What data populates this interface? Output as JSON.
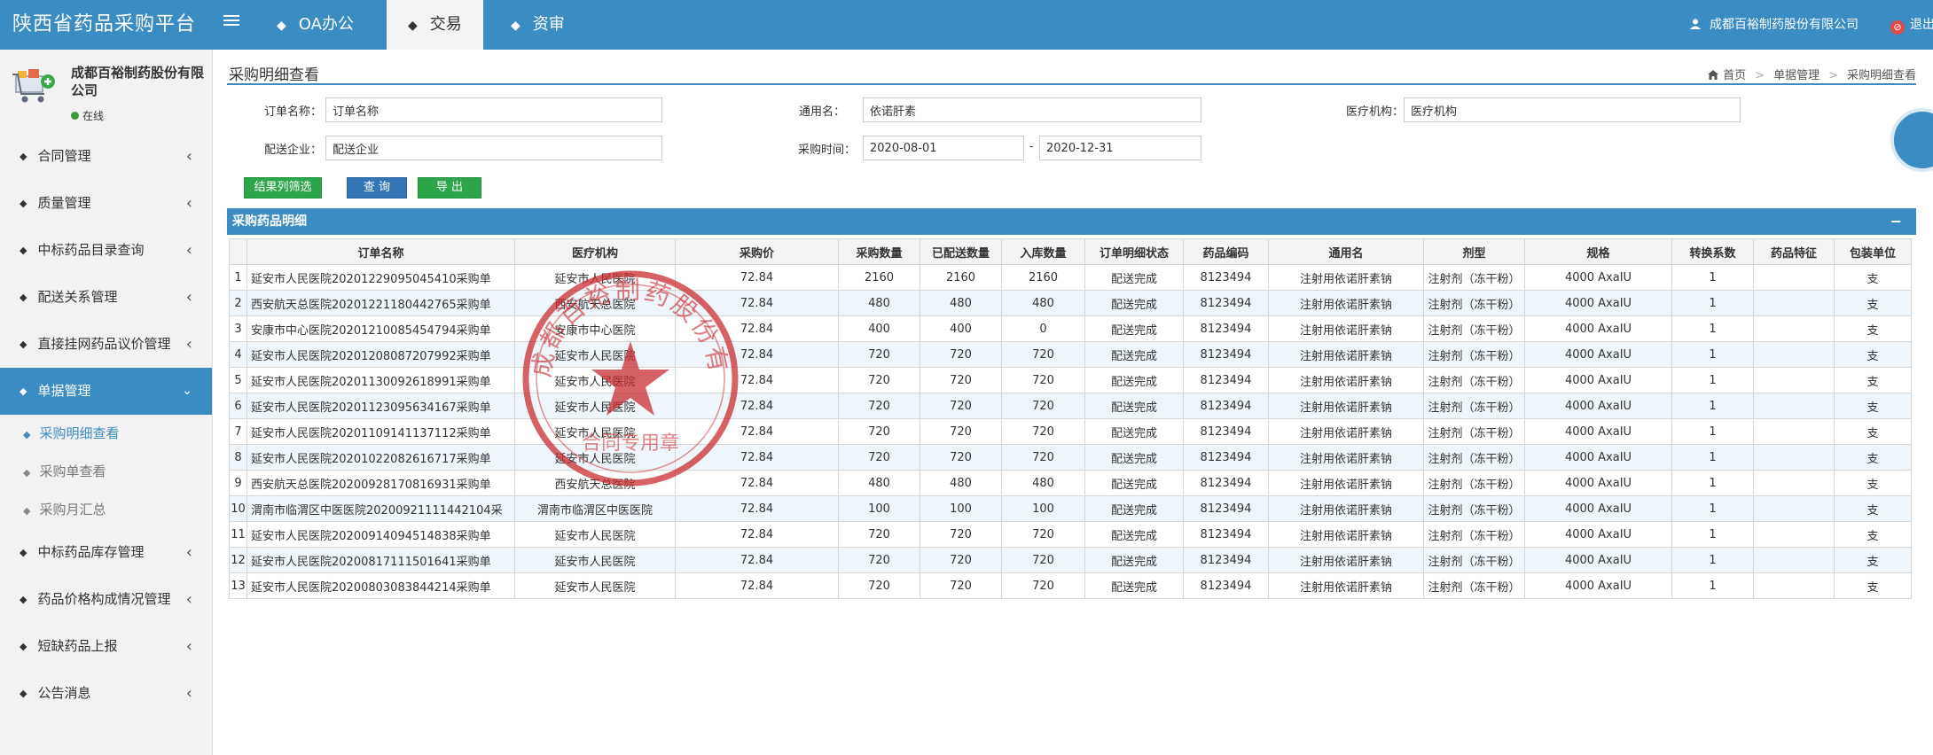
{
  "topbar": {
    "brand": "陕西省药品采购平台",
    "tabs": [
      {
        "label": "OA办公"
      },
      {
        "label": "交易"
      },
      {
        "label": "资审"
      }
    ],
    "user": "成都百裕制药股份有限公司",
    "logout": "退出"
  },
  "sidebar": {
    "profile": {
      "name": "成都百裕制药股份有限公司",
      "status": "在线"
    },
    "menu": [
      {
        "label": "合同管理"
      },
      {
        "label": "质量管理"
      },
      {
        "label": "中标药品目录查询"
      },
      {
        "label": "配送关系管理"
      },
      {
        "label": "直接挂网药品议价管理"
      },
      {
        "label": "单据管理"
      },
      {
        "label": "中标药品库存管理"
      },
      {
        "label": "药品价格构成情况管理"
      },
      {
        "label": "短缺药品上报"
      },
      {
        "label": "公告消息"
      }
    ],
    "submenu": [
      {
        "label": "采购明细查看"
      },
      {
        "label": "采购单查看"
      },
      {
        "label": "采购月汇总"
      }
    ]
  },
  "page": {
    "title": "采购明细查看",
    "breadcrumb": [
      "首页",
      "单据管理",
      "采购明细查看"
    ]
  },
  "filters": {
    "order_name": {
      "label": "订单名称：",
      "value": "订单名称"
    },
    "generic_name": {
      "label": "通用名：",
      "value": "依诺肝素"
    },
    "institution": {
      "label": "医疗机构：",
      "value": "医疗机构"
    },
    "distributor": {
      "label": "配送企业：",
      "value": "配送企业"
    },
    "purchase_time": {
      "label": "采购时间：",
      "from": "2020-08-01",
      "sep": "-",
      "to": "2020-12-31"
    }
  },
  "buttons": {
    "filter_columns": "结果列筛选",
    "query": "查 询",
    "export": "导 出"
  },
  "panel": {
    "title": "采购药品明细",
    "collapse": "−"
  },
  "table": {
    "headers": [
      "",
      "订单名称",
      "医疗机构",
      "采购价",
      "采购数量",
      "已配送数量",
      "入库数量",
      "订单明细状态",
      "药品编码",
      "通用名",
      "剂型",
      "规格",
      "转换系数",
      "药品特征",
      "包装单位"
    ],
    "rows": [
      [
        "1",
        "延安市人民医院20201229095045410采购单",
        "延安市人民医院",
        "72.84",
        "2160",
        "2160",
        "2160",
        "配送完成",
        "8123494",
        "注射用依诺肝素钠",
        "注射剂（冻干粉）",
        "4000 AxaIU",
        "1",
        "",
        "支"
      ],
      [
        "2",
        "西安航天总医院20201221180442765采购单",
        "西安航天总医院",
        "72.84",
        "480",
        "480",
        "480",
        "配送完成",
        "8123494",
        "注射用依诺肝素钠",
        "注射剂（冻干粉）",
        "4000 AxaIU",
        "1",
        "",
        "支"
      ],
      [
        "3",
        "安康市中心医院20201210085454794采购单",
        "安康市中心医院",
        "72.84",
        "400",
        "400",
        "0",
        "配送完成",
        "8123494",
        "注射用依诺肝素钠",
        "注射剂（冻干粉）",
        "4000 AxaIU",
        "1",
        "",
        "支"
      ],
      [
        "4",
        "延安市人民医院20201208087207992采购单",
        "延安市人民医院",
        "72.84",
        "720",
        "720",
        "720",
        "配送完成",
        "8123494",
        "注射用依诺肝素钠",
        "注射剂（冻干粉）",
        "4000 AxaIU",
        "1",
        "",
        "支"
      ],
      [
        "5",
        "延安市人民医院20201130092618991采购单",
        "延安市人民医院",
        "72.84",
        "720",
        "720",
        "720",
        "配送完成",
        "8123494",
        "注射用依诺肝素钠",
        "注射剂（冻干粉）",
        "4000 AxaIU",
        "1",
        "",
        "支"
      ],
      [
        "6",
        "延安市人民医院20201123095634167采购单",
        "延安市人民医院",
        "72.84",
        "720",
        "720",
        "720",
        "配送完成",
        "8123494",
        "注射用依诺肝素钠",
        "注射剂（冻干粉）",
        "4000 AxaIU",
        "1",
        "",
        "支"
      ],
      [
        "7",
        "延安市人民医院20201109141137112采购单",
        "延安市人民医院",
        "72.84",
        "720",
        "720",
        "720",
        "配送完成",
        "8123494",
        "注射用依诺肝素钠",
        "注射剂（冻干粉）",
        "4000 AxaIU",
        "1",
        "",
        "支"
      ],
      [
        "8",
        "延安市人民医院20201022082616717采购单",
        "延安市人民医院",
        "72.84",
        "720",
        "720",
        "720",
        "配送完成",
        "8123494",
        "注射用依诺肝素钠",
        "注射剂（冻干粉）",
        "4000 AxaIU",
        "1",
        "",
        "支"
      ],
      [
        "9",
        "西安航天总医院20200928170816931采购单",
        "西安航天总医院",
        "72.84",
        "480",
        "480",
        "480",
        "配送完成",
        "8123494",
        "注射用依诺肝素钠",
        "注射剂（冻干粉）",
        "4000 AxaIU",
        "1",
        "",
        "支"
      ],
      [
        "10",
        "渭南市临渭区中医医院20200921111442104采",
        "渭南市临渭区中医医院",
        "72.84",
        "100",
        "100",
        "100",
        "配送完成",
        "8123494",
        "注射用依诺肝素钠",
        "注射剂（冻干粉）",
        "4000 AxaIU",
        "1",
        "",
        "支"
      ],
      [
        "11",
        "延安市人民医院20200914094514838采购单",
        "延安市人民医院",
        "72.84",
        "720",
        "720",
        "720",
        "配送完成",
        "8123494",
        "注射用依诺肝素钠",
        "注射剂（冻干粉）",
        "4000 AxaIU",
        "1",
        "",
        "支"
      ],
      [
        "12",
        "延安市人民医院20200817111501641采购单",
        "延安市人民医院",
        "72.84",
        "720",
        "720",
        "720",
        "配送完成",
        "8123494",
        "注射用依诺肝素钠",
        "注射剂（冻干粉）",
        "4000 AxaIU",
        "1",
        "",
        "支"
      ],
      [
        "13",
        "延安市人民医院20200803083844214采购单",
        "延安市人民医院",
        "72.84",
        "720",
        "720",
        "720",
        "配送完成",
        "8123494",
        "注射用依诺肝素钠",
        "注射剂（冻干粉）",
        "4000 AxaIU",
        "1",
        "",
        "支"
      ]
    ]
  },
  "icons": {
    "menu_bullet": "diamond-icon",
    "expand": "chevron-left-icon",
    "expanded": "chevron-down-icon",
    "user": "user-icon",
    "logout": "logout-icon",
    "home": "home-icon"
  },
  "colors": {
    "primary": "#3a8cc3",
    "green": "#2da64a",
    "blue_button": "#3376b8",
    "stamp": "#c8262a",
    "online": "#3b9b3b"
  }
}
